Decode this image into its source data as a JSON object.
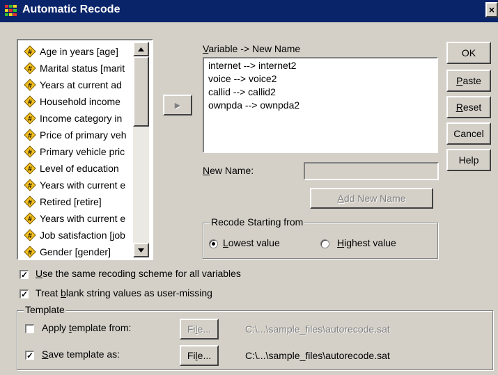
{
  "window": {
    "title": "Automatic Recode",
    "close_glyph": "×"
  },
  "variables": [
    {
      "label": "Age in years [age]"
    },
    {
      "label": "Marital status [marit"
    },
    {
      "label": "Years at current ad"
    },
    {
      "label": "Household income"
    },
    {
      "label": "Income category in"
    },
    {
      "label": "Price of primary veh"
    },
    {
      "label": "Primary vehicle pric"
    },
    {
      "label": "Level of education"
    },
    {
      "label": "Years with current e"
    },
    {
      "label": "Retired [retire]"
    },
    {
      "label": "Years with current e"
    },
    {
      "label": "Job satisfaction [job"
    },
    {
      "label": "Gender [gender]"
    }
  ],
  "transfer_button": {
    "glyph": "▶"
  },
  "mapping": {
    "label": "Variable -> New Name",
    "label_key": "V",
    "items": [
      "internet --> internet2",
      "voice --> voice2",
      "callid --> callid2",
      "ownpda --> ownpda2"
    ]
  },
  "new_name": {
    "label": "New Name:",
    "value": "",
    "add_button": "Add New Name"
  },
  "recode_group": {
    "label": "Recode Starting from",
    "options": [
      {
        "label": "Lowest value",
        "selected": true
      },
      {
        "label": "Highest value",
        "selected": false
      }
    ]
  },
  "buttons": {
    "ok": "OK",
    "paste": "Paste",
    "reset": "Reset",
    "cancel": "Cancel",
    "help": "Help"
  },
  "options": {
    "same_scheme": {
      "label": "Use the same recoding scheme for all variables",
      "checked": true
    },
    "blank_missing": {
      "label": "Treat blank string values as user-missing",
      "checked": true
    }
  },
  "template": {
    "label": "Template",
    "apply": {
      "label": "Apply template from:",
      "checked": false,
      "button": "File...",
      "path": "C:\\...\\sample_files\\autorecode.sat",
      "enabled": false
    },
    "save": {
      "label": "Save template as:",
      "checked": true,
      "button": "File...",
      "path": "C:\\...\\sample_files\\autorecode.sat",
      "enabled": true
    }
  },
  "colors": {
    "titlebar": "#0a246a",
    "dialog_bg": "#d4d0c8",
    "variable_icon": "#f4c020"
  }
}
